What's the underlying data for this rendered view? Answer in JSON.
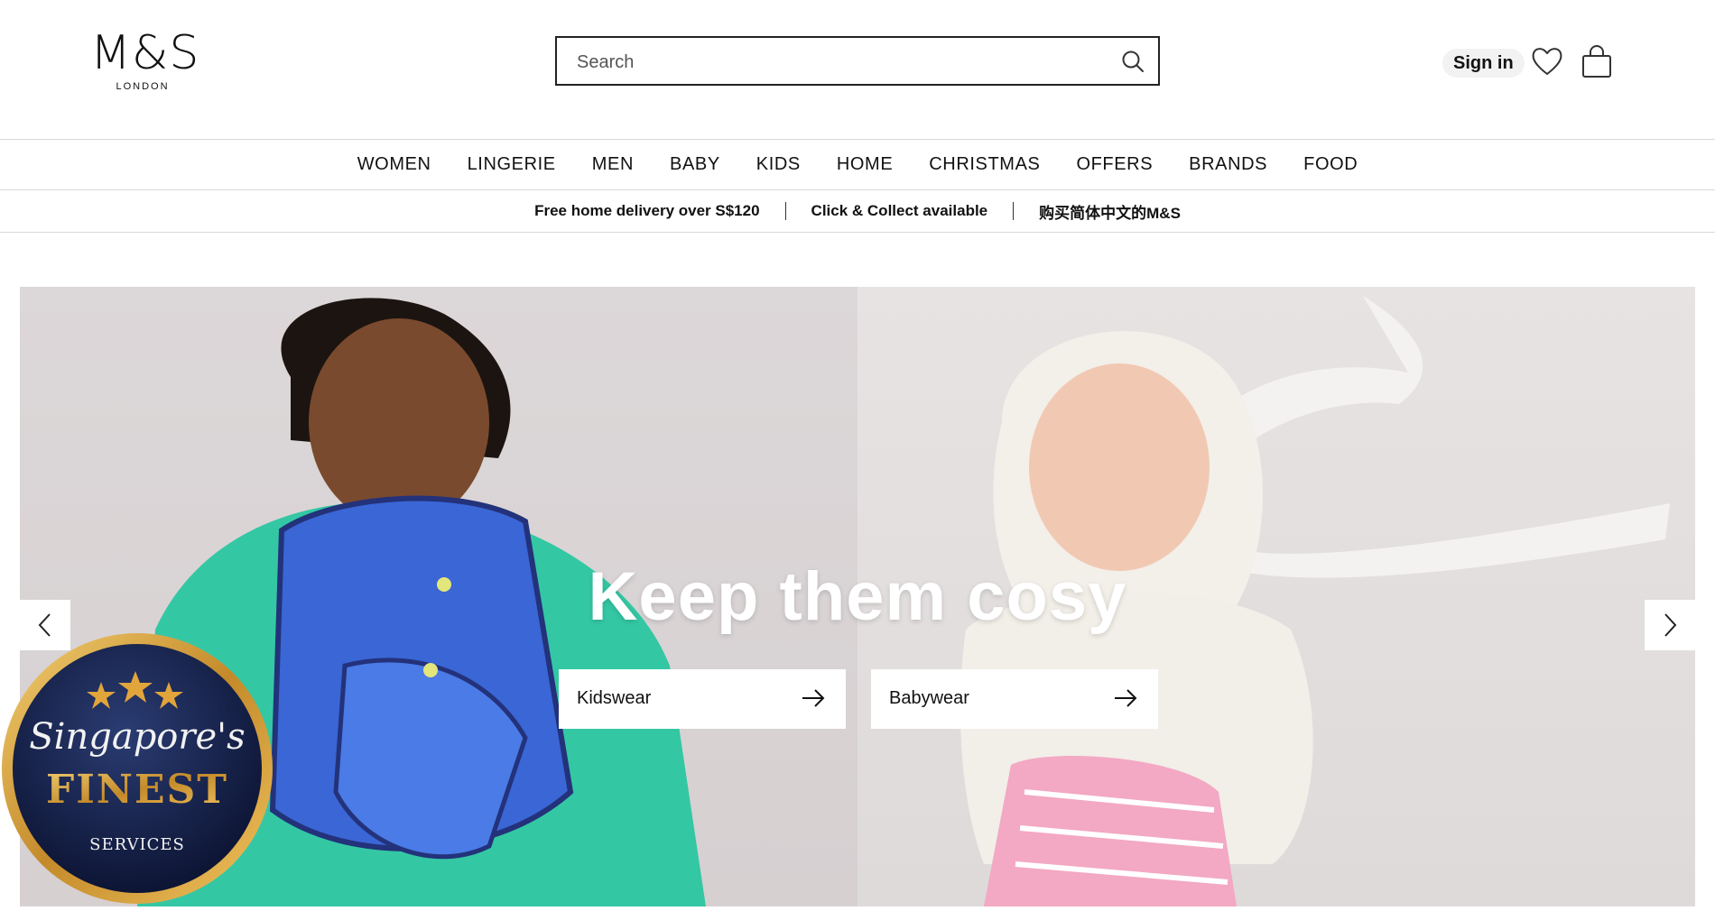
{
  "brand": {
    "name": "M&S",
    "tagline": "LONDON"
  },
  "search": {
    "placeholder": "Search"
  },
  "account": {
    "sign_in": "Sign in"
  },
  "icons": {
    "search": "search-icon",
    "wishlist": "heart-icon",
    "bag": "shopping-bag-icon",
    "prev": "chevron-left-icon",
    "next": "chevron-right-icon",
    "cta_arrow": "arrow-right-icon"
  },
  "nav": {
    "items": [
      {
        "label": "WOMEN"
      },
      {
        "label": "LINGERIE"
      },
      {
        "label": "MEN"
      },
      {
        "label": "BABY"
      },
      {
        "label": "KIDS"
      },
      {
        "label": "HOME"
      },
      {
        "label": "CHRISTMAS"
      },
      {
        "label": "OFFERS"
      },
      {
        "label": "BRANDS"
      },
      {
        "label": "FOOD"
      }
    ]
  },
  "promo_strip": {
    "items": [
      {
        "text": "Free home delivery over S$120"
      },
      {
        "text": "Click & Collect available"
      },
      {
        "text": "购买简体中文的M&S"
      }
    ]
  },
  "hero": {
    "heading": "Keep them cosy",
    "ctas": [
      {
        "label": "Kidswear"
      },
      {
        "label": "Babywear"
      }
    ]
  },
  "badge": {
    "line1": "Singapore's",
    "line2": "FINEST",
    "line3": "SERVICES"
  },
  "colors": {
    "text": "#111111",
    "border": "#d9d9d9",
    "hero_bg": "#e8e3e3",
    "badge_gold": "#d4a23a",
    "badge_navy": "#0f1a3d"
  }
}
